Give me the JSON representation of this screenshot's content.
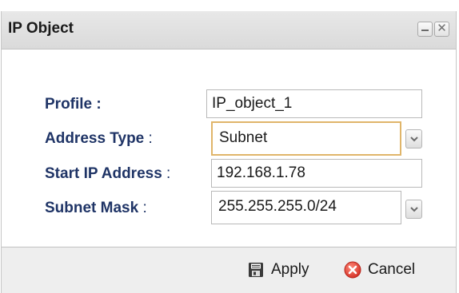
{
  "window": {
    "title": "IP Object",
    "minimize_symbol": "",
    "close_symbol": "✕"
  },
  "form": {
    "profile": {
      "label": "Profile :",
      "value": "IP_object_1"
    },
    "address_type": {
      "label": "Address Type",
      "colon": " :",
      "value": "Subnet"
    },
    "start_ip": {
      "label": "Start IP Address",
      "colon": " :",
      "value": "192.168.1.78"
    },
    "subnet_mask": {
      "label": "Subnet Mask",
      "colon": " :",
      "value": "255.255.255.0/24"
    }
  },
  "footer": {
    "apply_label": "Apply",
    "cancel_label": "Cancel"
  },
  "icons": {
    "minimize": "minimize-icon",
    "close": "close-icon",
    "dropdown": "chevron-down-icon",
    "apply": "save-icon",
    "cancel": "cancel-icon"
  },
  "colors": {
    "label_text": "#1f3466",
    "focus_border": "#e0b56a",
    "cancel_icon": "#e0453a"
  }
}
